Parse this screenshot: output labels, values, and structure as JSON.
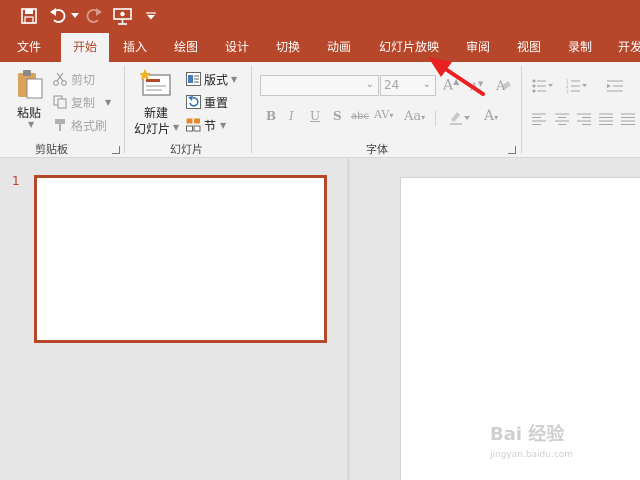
{
  "quick_access": {
    "icons": [
      "save-icon",
      "undo-icon",
      "redo-icon",
      "present-icon",
      "customize-icon"
    ]
  },
  "tabs": [
    {
      "label": "文件"
    },
    {
      "label": "开始"
    },
    {
      "label": "插入"
    },
    {
      "label": "绘图"
    },
    {
      "label": "设计"
    },
    {
      "label": "切换"
    },
    {
      "label": "动画"
    },
    {
      "label": "幻灯片放映"
    },
    {
      "label": "审阅"
    },
    {
      "label": "视图"
    },
    {
      "label": "录制"
    },
    {
      "label": "开发"
    }
  ],
  "active_tab": "开始",
  "ribbon": {
    "clipboard": {
      "paste": "粘贴",
      "cut": "剪切",
      "copy": "复制",
      "format_painter": "格式刷",
      "group_label": "剪贴板"
    },
    "slides": {
      "new_slide_line1": "新建",
      "new_slide_line2": "幻灯片",
      "layout": "版式",
      "reset": "重置",
      "section": "节",
      "group_label": "幻灯片"
    },
    "font": {
      "font_name_value": "",
      "font_size_value": "24",
      "strikethrough_label": "abc",
      "group_label": "字体"
    }
  },
  "thumbnails": [
    {
      "number": "1"
    }
  ],
  "watermark": {
    "brand": "Bai 经验",
    "url": "jingyan.baidu.com"
  },
  "colors": {
    "accent": "#b7472a",
    "annotation_arrow": "#e8201f"
  }
}
